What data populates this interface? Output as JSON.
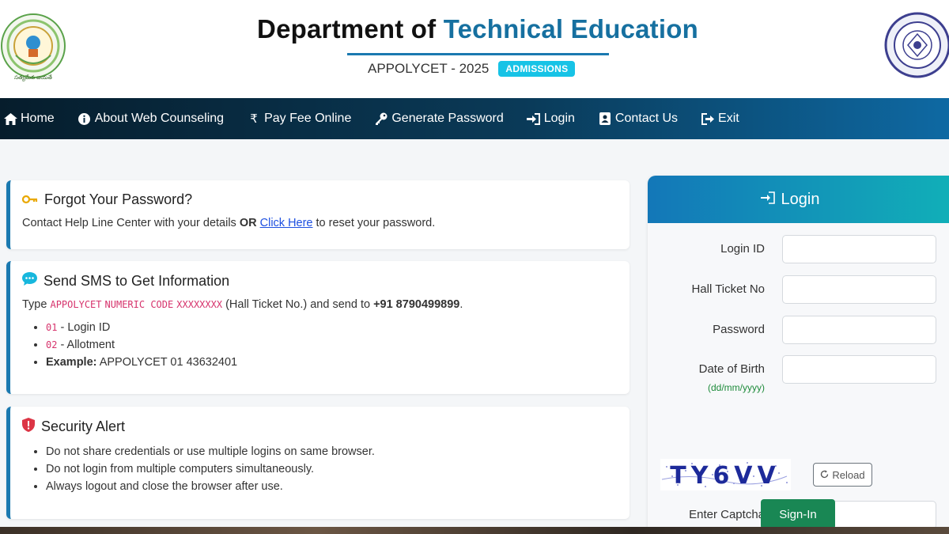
{
  "header": {
    "title_part1": "Department of ",
    "title_part2": "Technical Education",
    "subtitle": "APPOLYCET - 2025",
    "badge": "ADMISSIONS",
    "logo_left_text": "సత్యమేవ జయతే"
  },
  "nav": {
    "items": [
      {
        "label": "Home",
        "icon": "home-icon"
      },
      {
        "label": "About Web Counseling",
        "icon": "info-icon"
      },
      {
        "label": "Pay Fee Online",
        "icon": "rupee-icon"
      },
      {
        "label": "Generate Password",
        "icon": "key-icon"
      },
      {
        "label": "Login",
        "icon": "login-icon"
      },
      {
        "label": "Contact Us",
        "icon": "contact-icon"
      },
      {
        "label": "Exit",
        "icon": "exit-icon"
      }
    ]
  },
  "forgot": {
    "title": "Forgot Your Password?",
    "text_before": "Contact Help Line Center with your details ",
    "or": "OR",
    "link": "Click Here",
    "text_after": " to reset your password."
  },
  "sms": {
    "title": "Send SMS to Get Information",
    "type_label": "Type ",
    "code1": "APPOLYCET",
    "code2": "NUMERIC CODE",
    "code3": "XXXXXXXX",
    "text_mid": " (Hall Ticket No.) and send to ",
    "number": "+91 8790499899",
    "period": ".",
    "item1_code": "01",
    "item1_text": " - Login ID",
    "item2_code": "02",
    "item2_text": " - Allotment",
    "example_label": "Example:",
    "example_text": " APPOLYCET 01 43632401"
  },
  "security": {
    "title": "Security Alert",
    "items": [
      "Do not share credentials or use multiple logins on same browser.",
      "Do not login from multiple computers simultaneously.",
      "Always logout and close the browser after use."
    ]
  },
  "login": {
    "title": "Login",
    "login_id_label": "Login ID",
    "hall_ticket_label": "Hall Ticket No",
    "password_label": "Password",
    "dob_label": "Date of Birth",
    "dob_hint": "(dd/mm/yyyy)",
    "captcha_text": "TY6VV",
    "reload_label": "Reload",
    "captcha_label": "Enter Captcha",
    "signin_label": "Sign-In",
    "login_id_value": "",
    "hall_ticket_value": "",
    "password_value": "",
    "dob_value": "",
    "captcha_value": ""
  },
  "colors": {
    "accent": "#1670a0",
    "badge": "#17c3e6",
    "signin": "#198754",
    "code": "#d6336c"
  }
}
